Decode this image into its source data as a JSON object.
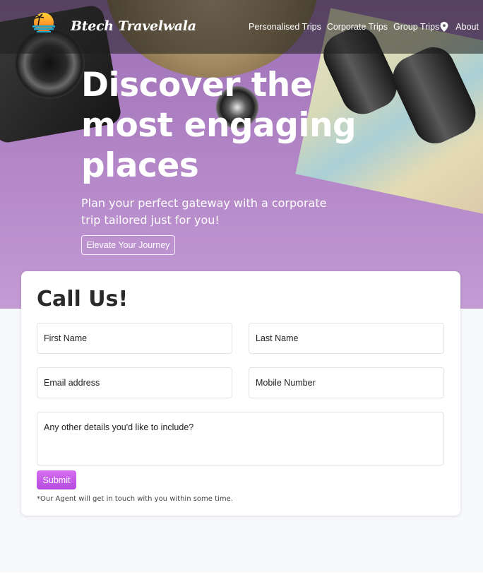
{
  "brand": {
    "name": "Btech Travelwala",
    "logo_icon": "sunset-palm-logo"
  },
  "nav": {
    "items": [
      "Personalised Trips",
      "Corporate Trips",
      "Group Trips",
      "About"
    ],
    "location_icon": "map-pin-icon"
  },
  "hero": {
    "title": "Discover the most engaging places",
    "subtitle": "Plan your perfect gateway with a corporate trip tailored just for you!",
    "cta_label": "Elevate Your Journey"
  },
  "form": {
    "title": "Call Us!",
    "first_name_placeholder": "First Name",
    "last_name_placeholder": "Last Name",
    "email_placeholder": "Email address",
    "mobile_placeholder": "Mobile Number",
    "details_placeholder": "Any other details you'd like to include?",
    "submit_label": "Submit",
    "note": "*Our Agent will get in touch with you within some time."
  },
  "colors": {
    "hero_purple": "#b487c8",
    "submit_purple": "#c35de8",
    "page_background": "#f7f8fc"
  }
}
